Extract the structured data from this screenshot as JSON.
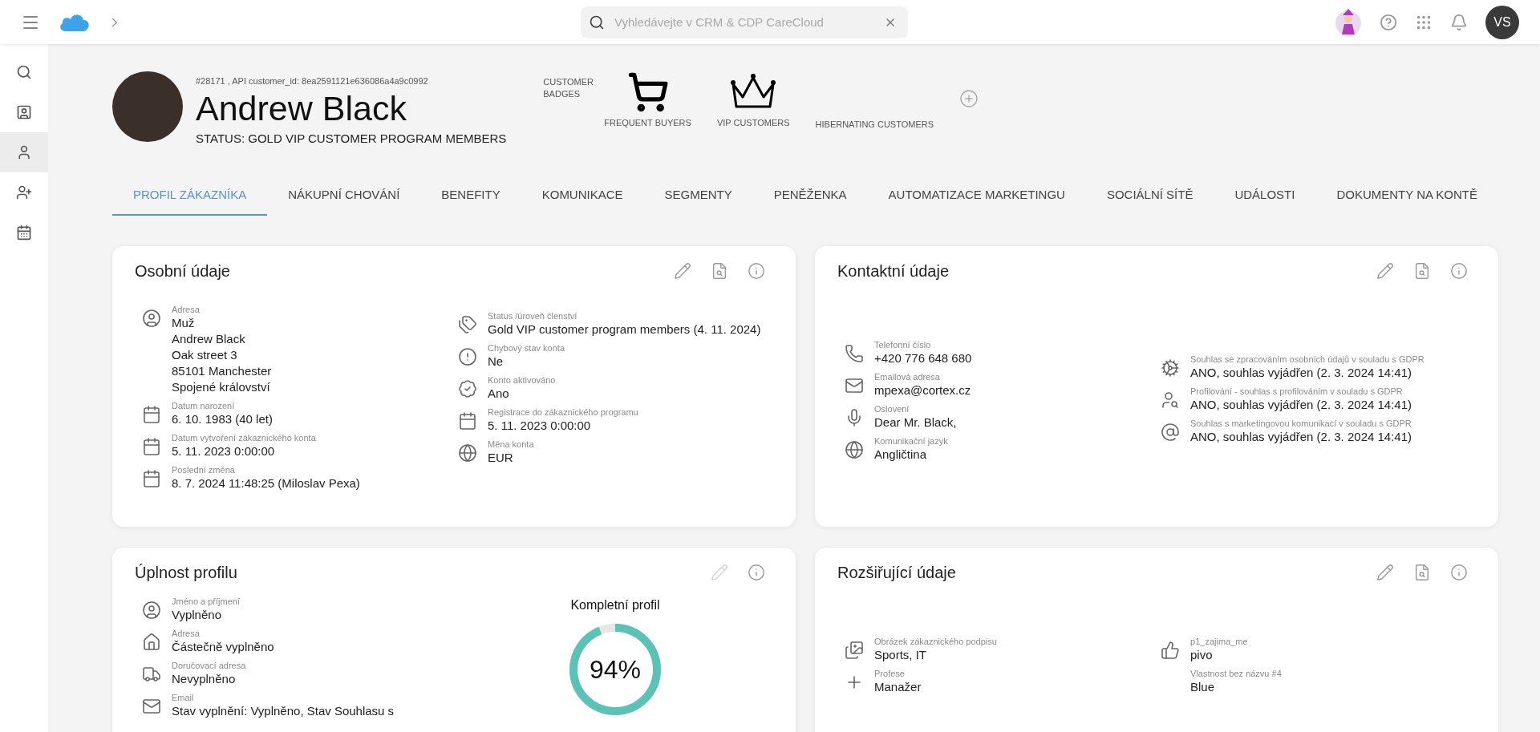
{
  "topbar": {
    "search": {
      "placeholder": "Vyhledávejte v CRM & CDP CareCloud"
    },
    "user_initials": "VS"
  },
  "sidebar": {
    "items": [
      {
        "selected": false
      },
      {
        "selected": false
      },
      {
        "selected": true
      },
      {
        "selected": false
      },
      {
        "selected": false
      }
    ]
  },
  "customer": {
    "id_line": "#28171 , API customer_id: 8ea2591121e636086a4a9c0992",
    "name": "Andrew Black",
    "status": "STATUS: GOLD VIP CUSTOMER PROGRAM MEMBERS",
    "badges_label": "CUSTOMER BADGES",
    "badges": [
      {
        "kind": "cart",
        "label": "FREQUENT BUYERS"
      },
      {
        "kind": "vip",
        "label": "VIP CUSTOMERS"
      },
      {
        "kind": "none",
        "label": "HIBERNATING CUSTOMERS"
      }
    ]
  },
  "tabs": [
    {
      "label": "PROFIL ZÁKAZNÍKA",
      "selected": true
    },
    {
      "label": "NÁKUPNÍ CHOVÁNÍ",
      "selected": false
    },
    {
      "label": "BENEFITY",
      "selected": false
    },
    {
      "label": "KOMUNIKACE",
      "selected": false
    },
    {
      "label": "SEGMENTY",
      "selected": false
    },
    {
      "label": "PENĚŽENKA",
      "selected": false
    },
    {
      "label": "AUTOMATIZACE MARKETINGU",
      "selected": false
    },
    {
      "label": "SOCIÁLNÍ SÍTĚ",
      "selected": false
    },
    {
      "label": "UDÁLOSTI",
      "selected": false
    },
    {
      "label": "DOKUMENTY NA KONTĚ",
      "selected": false
    }
  ],
  "cards": [
    {
      "title": "Osobní údaje",
      "actions": [
        {
          "kind": "edit",
          "disabled": false
        },
        {
          "kind": "preview",
          "disabled": false
        },
        {
          "kind": "info",
          "disabled": false
        }
      ],
      "columns": [
        [
          {
            "label": "Adresa",
            "lines": [
              "Muž",
              "Andrew Black",
              "Oak street 3",
              "85101 Manchester",
              "Spojené království"
            ]
          },
          {
            "label": "Datum narození",
            "lines": [
              "6. 10. 1983 (40 let)"
            ]
          },
          {
            "label": "Datum vytvoření zákaznického konta",
            "lines": [
              "5. 11. 2023 0:00:00"
            ]
          },
          {
            "label": "Poslední změna",
            "lines": [
              "8. 7. 2024 11:48:25 (Miloslav Pexa)"
            ]
          }
        ],
        [
          {
            "label": "Status /úroveň členství",
            "lines": [
              "Gold VIP customer program members (4. 11. 2024)"
            ]
          },
          {
            "label": "Chybový stav konta",
            "lines": [
              "Ne"
            ]
          },
          {
            "label": "Konto aktivováno",
            "lines": [
              "Ano"
            ]
          },
          {
            "label": "Registrace do zákaznického programu",
            "lines": [
              "5. 11. 2023 0:00:00"
            ]
          },
          {
            "label": "Měna konta",
            "lines": [
              "EUR"
            ]
          }
        ]
      ]
    },
    {
      "title": "Kontaktní údaje",
      "actions": [
        {
          "kind": "edit",
          "disabled": false
        },
        {
          "kind": "preview",
          "disabled": false
        },
        {
          "kind": "info",
          "disabled": false
        }
      ],
      "columns": [
        [
          {
            "label": "Telefonní číslo",
            "lines": [
              "+420 776 648 680"
            ]
          },
          {
            "label": "Emailová adresa",
            "lines": [
              "mpexa@cortex.cz"
            ]
          },
          {
            "label": "Oslovení",
            "lines": [
              "Dear Mr. Black,"
            ]
          },
          {
            "label": "Komunikační jazyk",
            "lines": [
              "Angličtina"
            ]
          }
        ],
        [
          {
            "label": "Souhlas se zpracováním osobních údajů v souladu s GDPR",
            "lines": [
              "ANO, souhlas vyjádřen (2. 3. 2024 14:41)"
            ]
          },
          {
            "label": "Profilování - souhlas s profilováním v souladu s GDPR",
            "lines": [
              "ANO, souhlas vyjádřen (2. 3. 2024 14:41)"
            ]
          },
          {
            "label": "Souhlas s marketingovou komunikací v souladu s GDPR",
            "lines": [
              "ANO, souhlas vyjádřen (2. 3. 2024 14:41)"
            ]
          }
        ]
      ]
    },
    {
      "title": "Úplnost profilu",
      "actions": [
        {
          "kind": "edit",
          "disabled": true
        },
        {
          "kind": "info",
          "disabled": false
        }
      ],
      "columns": [
        [
          {
            "label": "Jméno a příjmení",
            "lines": [
              "Vyplněno"
            ]
          },
          {
            "label": "Adresa",
            "lines": [
              "Částečně vyplněno"
            ]
          },
          {
            "label": "Doručovací adresa",
            "lines": [
              "Nevyplněno"
            ]
          },
          {
            "label": "Email",
            "lines": [
              "Stav vyplnění: Vyplněno, Stav Souhlasu s"
            ]
          }
        ]
      ],
      "meter": {
        "title": "Kompletní profil",
        "level": 0.94,
        "reading": "94%"
      }
    },
    {
      "title": "Rozšiřující údaje",
      "actions": [
        {
          "kind": "edit",
          "disabled": false
        },
        {
          "kind": "preview",
          "disabled": false
        },
        {
          "kind": "info",
          "disabled": false
        }
      ],
      "columns": [
        [
          {
            "label": "Obrázek zákaznického podpisu",
            "lines": [
              "Sports, IT"
            ]
          },
          {
            "label": "Profese",
            "lines": [
              "Manažer"
            ]
          }
        ],
        [
          {
            "label": "p1_zajima_me",
            "lines": [
              "pivo"
            ]
          },
          {
            "label": "Vlastnost bez názvu #4",
            "lines": [
              "Blue"
            ]
          }
        ]
      ]
    }
  ]
}
